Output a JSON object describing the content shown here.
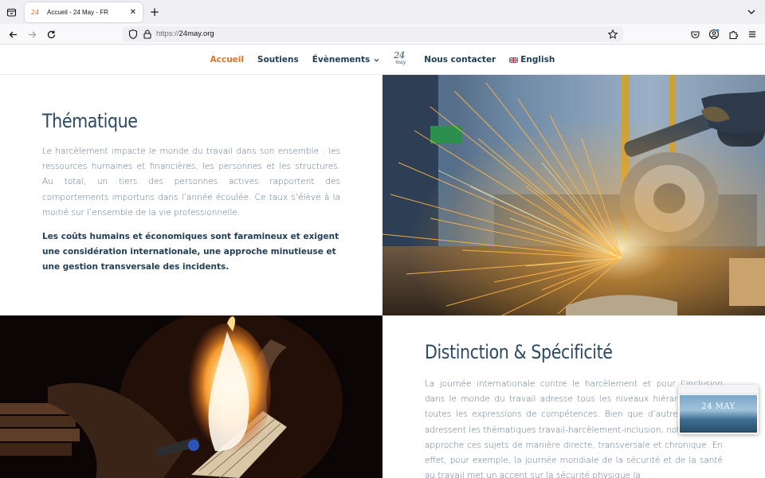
{
  "browser": {
    "tab_title": "Accueil - 24 May - FR",
    "tab_favicon_text": "24",
    "url_protocol": "https://",
    "url_domain": "24may.org"
  },
  "site": {
    "logo_text": "24",
    "logo_script": "may",
    "menu": [
      {
        "label": "Accueil",
        "active": true
      },
      {
        "label": "Soutiens",
        "active": false
      },
      {
        "label": "Évènements",
        "active": false
      },
      {
        "label": "Nous contacter",
        "active": false
      },
      {
        "label": "English",
        "active": false
      }
    ]
  },
  "sections": {
    "thematique": {
      "title": "Thématique",
      "paragraph": "Le harcèlement impacte le monde du travail dans son ensemble : les ressources humaines et financières, les personnes et les structures. Au total, un tiers des personnes actives rapportent des comportements importuns dans l’année écoulée. Ce taux s’élève à la moitié sur l’ensemble de la vie professionnelle.",
      "bold_paragraph": "Les coûts humains et économiques sont faramineux et exigent une considération internationale, une approche minutieuse et une gestion transversale des incidents."
    },
    "distinction": {
      "title": "Distinction & Spécificité",
      "paragraph": "La journée internationale contre le harcèlement et pour l’inclusion dans le monde du travail adresse tous les niveaux hiérarchiques et toutes les expressions de compétences. Bien que d’autres journées adressent les thématiques travail-harcèlement-inclusion, notre journée approche ces sujets de manière directe, transversale et chronique. En effet, pour exemple, la journée mondiale de la sécurité et de la santé au travail met un accent sur la sécurité physique la"
    }
  },
  "preview": {
    "title": "24 MAY"
  },
  "colors": {
    "accent": "#d8782f",
    "heading": "#2c4a63",
    "body_text": "#58708a"
  }
}
